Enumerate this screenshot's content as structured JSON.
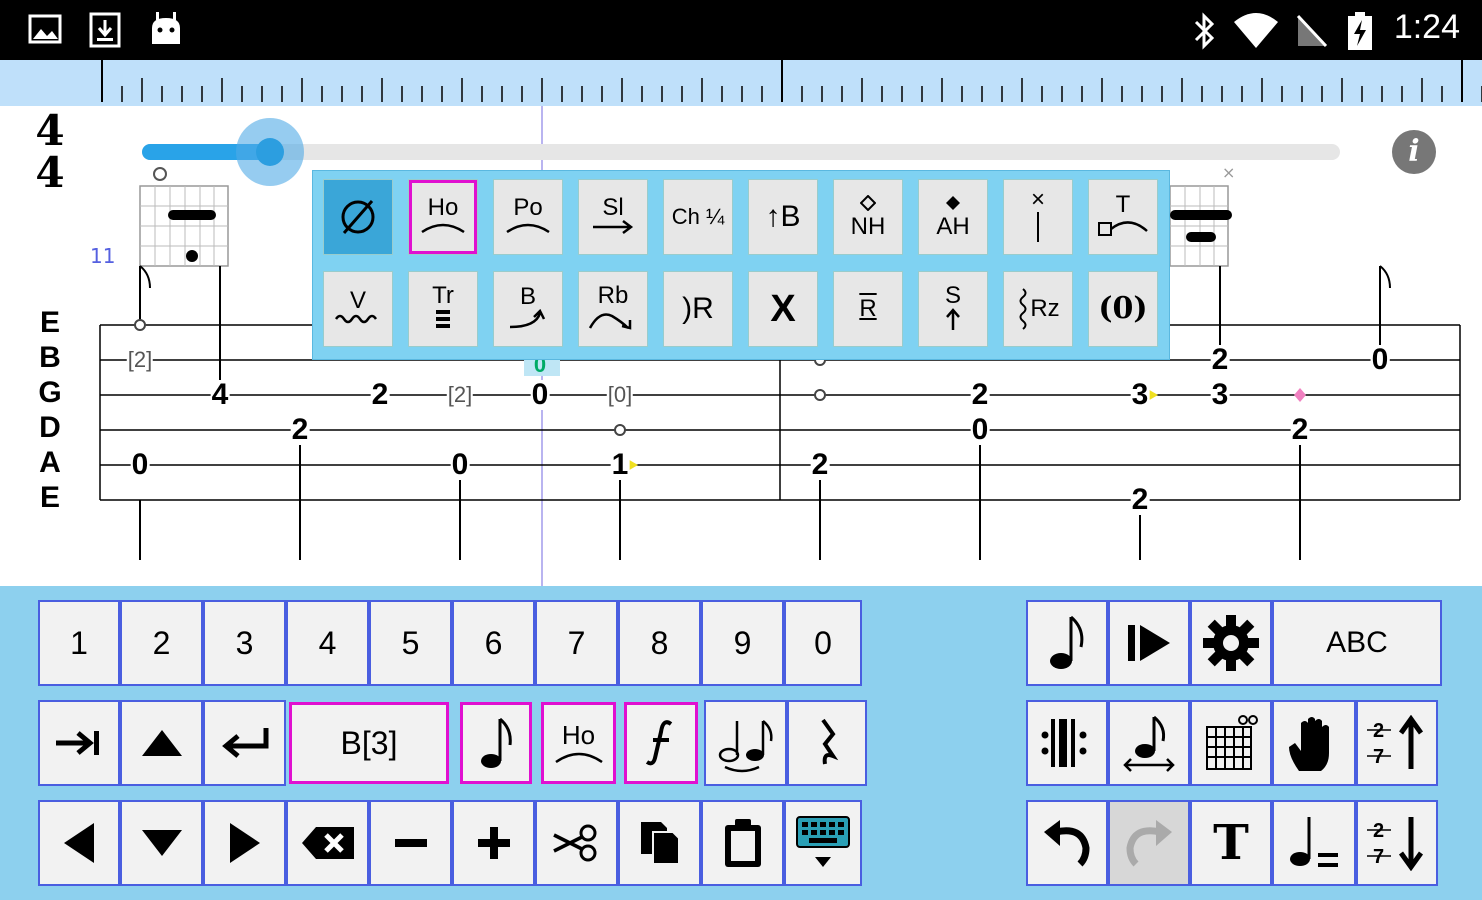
{
  "status_bar": {
    "time": "1:24",
    "left_icons": [
      "image-icon",
      "download-icon",
      "android-icon"
    ],
    "right_icons": [
      "bluetooth-icon",
      "wifi-icon",
      "no-sim-icon",
      "battery-charging-icon"
    ]
  },
  "score": {
    "time_signature": {
      "top": "4",
      "bottom": "4"
    },
    "measure_number": "11",
    "string_labels": [
      "E",
      "B",
      "G",
      "D",
      "A",
      "E"
    ],
    "info_label": "i",
    "notes": [
      {
        "text": "[2]",
        "small": true
      },
      {
        "text": "4"
      },
      {
        "text": "2"
      },
      {
        "text": "2"
      },
      {
        "text": "[2]",
        "small": true
      },
      {
        "text": "0"
      },
      {
        "text": "0"
      },
      {
        "text": "0"
      },
      {
        "text": "[0]",
        "small": true
      },
      {
        "text": "1"
      },
      {
        "text": "0"
      },
      {
        "text": "2"
      },
      {
        "text": "2"
      },
      {
        "text": "0"
      },
      {
        "text": "3"
      },
      {
        "text": "2"
      },
      {
        "text": "3"
      },
      {
        "text": "2"
      },
      {
        "text": "0"
      },
      {
        "text": "2"
      },
      {
        "text": "0"
      }
    ]
  },
  "palette": {
    "row1": [
      {
        "name": "none",
        "label": "∅",
        "selected": true
      },
      {
        "name": "hammer-on",
        "label": "Ho",
        "outlined": true
      },
      {
        "name": "pull-off",
        "label": "Po"
      },
      {
        "name": "slide",
        "label": "Sl"
      },
      {
        "name": "choke",
        "label": "Ch ¼"
      },
      {
        "name": "bend",
        "label": "↑B"
      },
      {
        "name": "natural-harmonic",
        "label": "NH"
      },
      {
        "name": "artificial-harmonic",
        "label": "AH"
      },
      {
        "name": "dead-note-stroke",
        "label": "×"
      },
      {
        "name": "tap",
        "label": "T"
      }
    ],
    "row2": [
      {
        "name": "vibrato",
        "label": "V"
      },
      {
        "name": "tremolo",
        "label": "Tr"
      },
      {
        "name": "bend-release",
        "label": "B"
      },
      {
        "name": "release-bend",
        "label": "Rb"
      },
      {
        "name": "release",
        "label": ")R"
      },
      {
        "name": "dead-note",
        "label": "X"
      },
      {
        "name": "repeat",
        "label": "R"
      },
      {
        "name": "strum",
        "label": "S"
      },
      {
        "name": "rasgueado",
        "label": "Rz"
      },
      {
        "name": "ghost-note",
        "label": "(0)"
      }
    ]
  },
  "keyboard": {
    "digits": [
      "1",
      "2",
      "3",
      "4",
      "5",
      "6",
      "7",
      "8",
      "9",
      "0"
    ],
    "string_label": "B[3]",
    "abc_label": "ABC",
    "text_label": "T",
    "hammer_label": "Ho"
  }
}
